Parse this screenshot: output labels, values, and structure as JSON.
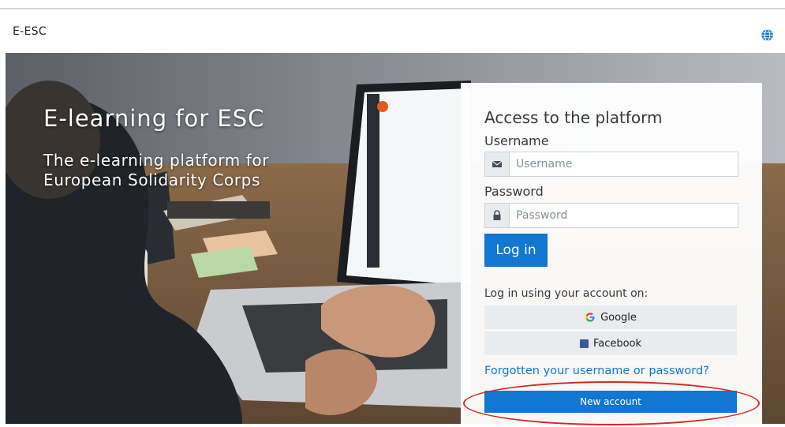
{
  "header": {
    "brand": "E-ESC",
    "language_icon": "globe-icon"
  },
  "hero": {
    "title": "E-learning for ESC",
    "subtitle": "The e-learning platform for European Solidarity Corps",
    "background": "photo of person typing on a laptop at a desk"
  },
  "login": {
    "title": "Access to the platform",
    "username_label": "Username",
    "username_placeholder": "Username",
    "username_icon": "envelope-icon",
    "password_label": "Password",
    "password_placeholder": "Password",
    "password_icon": "lock-icon",
    "login_button": "Log in",
    "sso_label": "Log in using your account on:",
    "sso_providers": [
      {
        "label": "Google",
        "icon": "google-icon"
      },
      {
        "label": "Facebook",
        "icon": "facebook-icon"
      }
    ],
    "forgot_link": "Forgotten your username or password?",
    "new_account_button": "New account"
  },
  "colors": {
    "primary": "#1177d1",
    "annotation_circle": "#d7281e",
    "addon_bg": "#e9ecef"
  }
}
